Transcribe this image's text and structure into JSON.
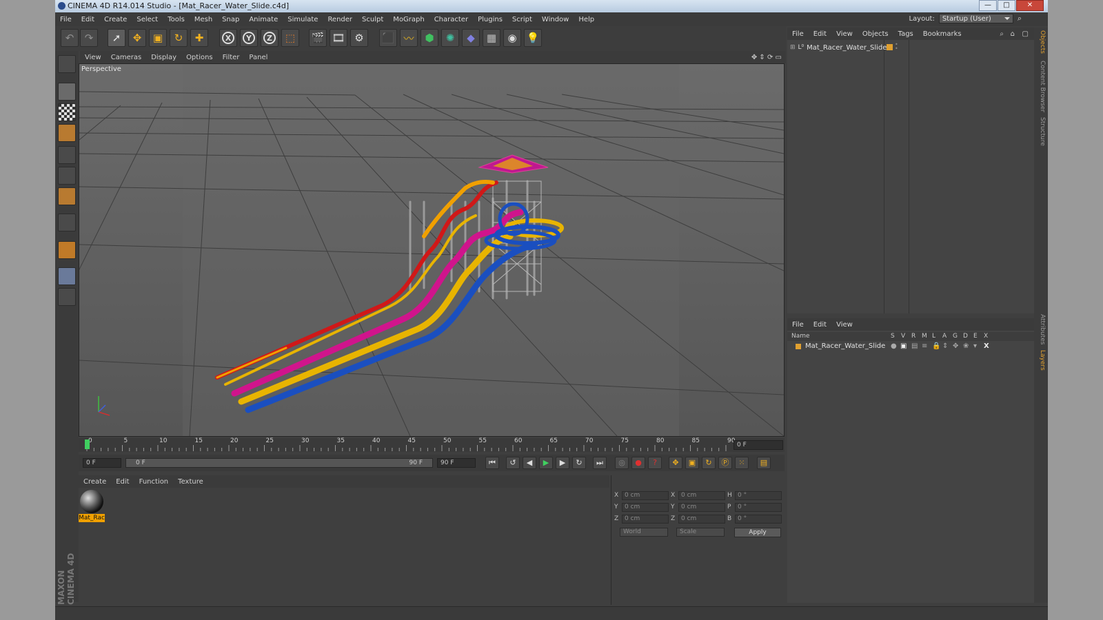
{
  "window": {
    "title": "CINEMA 4D R14.014 Studio - [Mat_Racer_Water_Slide.c4d]",
    "buttons": {
      "minimize": "—",
      "maximize": "□",
      "close": "✕"
    }
  },
  "menubar": {
    "items": [
      "File",
      "Edit",
      "Create",
      "Select",
      "Tools",
      "Mesh",
      "Snap",
      "Animate",
      "Simulate",
      "Render",
      "Sculpt",
      "MoGraph",
      "Character",
      "Plugins",
      "Script",
      "Window",
      "Help"
    ],
    "layout_label": "Layout:",
    "layout_value": "Startup (User)"
  },
  "toolbar": {
    "axes": [
      "X",
      "Y",
      "Z"
    ]
  },
  "viewport": {
    "menu": [
      "View",
      "Cameras",
      "Display",
      "Options",
      "Filter",
      "Panel"
    ],
    "label": "Perspective"
  },
  "timeline": {
    "ticks": [
      "0",
      "5",
      "10",
      "15",
      "20",
      "25",
      "30",
      "35",
      "40",
      "45",
      "50",
      "55",
      "60",
      "65",
      "70",
      "75",
      "80",
      "85",
      "90"
    ],
    "current_frame": "0 F",
    "start_field": "0 F",
    "range_start": "0 F",
    "range_end": "90 F",
    "end_field": "90 F"
  },
  "materials": {
    "menu": [
      "Create",
      "Edit",
      "Function",
      "Texture"
    ],
    "items": [
      {
        "name": "Mat_Rac"
      }
    ]
  },
  "coordinates": {
    "rows": [
      {
        "a_label": "X",
        "a_val": "0 cm",
        "b_label": "X",
        "b_val": "0 cm",
        "c_label": "H",
        "c_val": "0 °"
      },
      {
        "a_label": "Y",
        "a_val": "0 cm",
        "b_label": "Y",
        "b_val": "0 cm",
        "c_label": "P",
        "c_val": "0 °"
      },
      {
        "a_label": "Z",
        "a_val": "0 cm",
        "b_label": "Z",
        "b_val": "0 cm",
        "c_label": "B",
        "c_val": "0 °"
      }
    ],
    "mode": "World",
    "scale": "Scale",
    "apply": "Apply"
  },
  "objects_panel": {
    "menu": [
      "File",
      "Edit",
      "View",
      "Objects",
      "Tags",
      "Bookmarks"
    ],
    "item": "Mat_Racer_Water_Slide"
  },
  "layers_panel": {
    "menu": [
      "File",
      "Edit",
      "View"
    ],
    "columns": [
      "Name",
      "S",
      "V",
      "R",
      "M",
      "L",
      "A",
      "G",
      "D",
      "E",
      "X"
    ],
    "item": "Mat_Racer_Water_Slide"
  },
  "side_tabs": [
    "Objects",
    "Content Browser",
    "Structure",
    "Attributes",
    "Layers"
  ],
  "brand": "MAXON CINEMA 4D",
  "colors": {
    "accent": "#f0b020",
    "slide_red": "#d01818",
    "slide_magenta": "#d0148c",
    "slide_yellow": "#e8b400",
    "slide_blue": "#1a4fc0",
    "slide_orange": "#f0a000"
  }
}
